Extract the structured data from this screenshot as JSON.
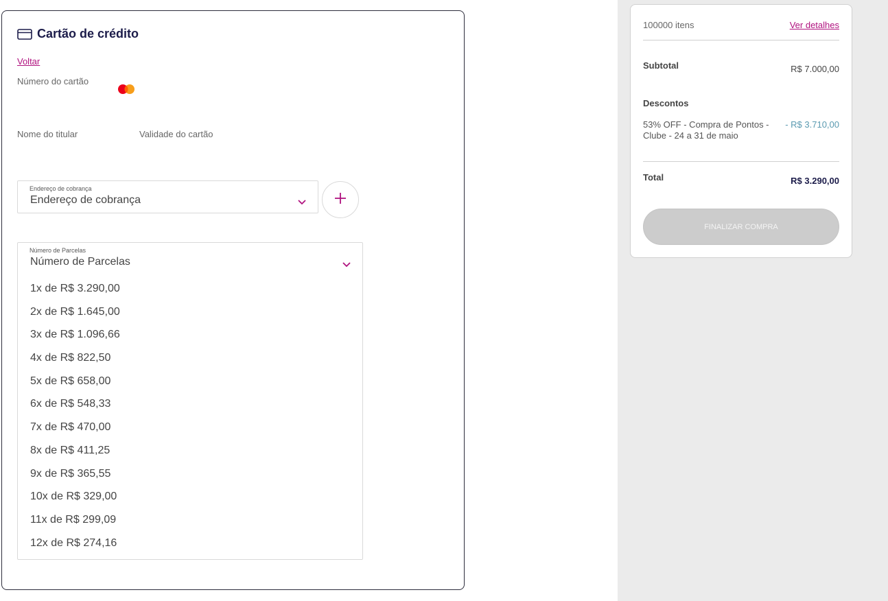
{
  "payment": {
    "title": "Cartão de crédito",
    "back_label": "Voltar",
    "card_number_label": "Número do cartão",
    "holder_label": "Nome do titular",
    "validity_label": "Validade do cartão",
    "billing": {
      "float_label": "Endereço de cobrança",
      "value": "Endereço de cobrança"
    },
    "installments": {
      "float_label": "Número de Parcelas",
      "value": "Número de Parcelas",
      "options": [
        "1x de R$ 3.290,00",
        "2x de R$ 1.645,00",
        "3x de R$ 1.096,66",
        "4x de R$ 822,50",
        "5x de R$ 658,00",
        "6x de R$ 548,33",
        "7x de R$ 470,00",
        "8x de R$ 411,25",
        "9x de R$ 365,55",
        "10x de R$ 329,00",
        "11x de R$ 299,09",
        "12x de R$ 274,16"
      ]
    }
  },
  "summary": {
    "items": "100000 itens",
    "details_link": "Ver detalhes",
    "subtotal_label": "Subtotal",
    "subtotal_value": "R$ 7.000,00",
    "discounts_label": "Descontos",
    "discount_text": "53% OFF - Compra de Pontos - Clube - 24 a 31 de maio",
    "discount_value": "- R$ 3.710,00",
    "total_label": "Total",
    "total_value": "R$ 3.290,00",
    "finish_button": "FINALIZAR COMPRA"
  },
  "colors": {
    "accent": "#b0127f",
    "title": "#1c1c4a",
    "discount": "#5a9ab0",
    "disabled_button": "#cccccc",
    "right_background": "#ebebeb"
  },
  "icons": [
    "credit-card-icon",
    "mastercard-icon",
    "chevron-down-icon",
    "plus-icon"
  ]
}
